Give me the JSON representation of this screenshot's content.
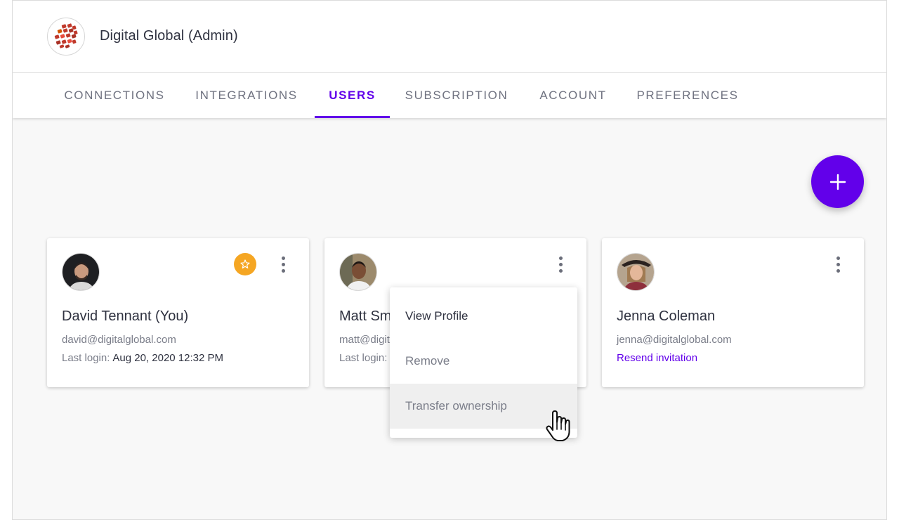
{
  "header": {
    "org_title": "Digital Global (Admin)"
  },
  "tabs": [
    {
      "label": "CONNECTIONS",
      "active": false
    },
    {
      "label": "INTEGRATIONS",
      "active": false
    },
    {
      "label": "USERS",
      "active": true
    },
    {
      "label": "SUBSCRIPTION",
      "active": false
    },
    {
      "label": "ACCOUNT",
      "active": false
    },
    {
      "label": "PREFERENCES",
      "active": false
    }
  ],
  "fab": {
    "icon": "plus-icon"
  },
  "users": [
    {
      "name": "David Tennant (You)",
      "email": "david@digitalglobal.com",
      "last_login_label": "Last login:",
      "last_login_value": "Aug 20, 2020 12:32 PM",
      "owner_icon": "star-icon"
    },
    {
      "name": "Matt Smith",
      "email": "matt@digitalglobal.com",
      "last_login_label": "Last login:"
    },
    {
      "name": "Jenna Coleman",
      "email": "jenna@digitalglobal.com",
      "resend_label": "Resend invitation"
    }
  ],
  "context_menu": {
    "items": [
      "View Profile",
      "Remove",
      "Transfer ownership"
    ],
    "hovered": "Transfer ownership"
  },
  "colors": {
    "accent": "#6200ea",
    "owner_badge": "#f5a623"
  }
}
